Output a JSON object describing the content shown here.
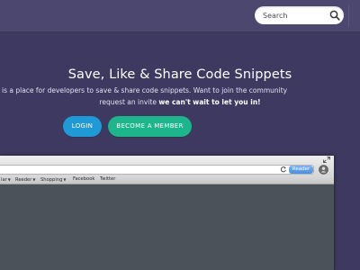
{
  "search": {
    "placeholder": "Search",
    "icon": "search-icon"
  },
  "hero": {
    "title": "Save, Like & Share Code Snippets",
    "line1": "is a place for developers to save & share code snippets. Want to join the community",
    "line2_plain": "request an invite ",
    "line2_bold": "we can't wait to let you in!"
  },
  "buttons": {
    "login": "LOGIN",
    "member": "BECOME A MEMBER"
  },
  "browser": {
    "reader_label": "Reader",
    "bookmarks": [
      {
        "label": "lar",
        "has_menu": true
      },
      {
        "label": "Reeder",
        "has_menu": true
      },
      {
        "label": "Shopping",
        "has_menu": true
      },
      {
        "label": "Facebook",
        "has_menu": false
      },
      {
        "label": "Twitter",
        "has_menu": false
      }
    ]
  },
  "colors": {
    "background": "#3e3960",
    "topbar": "#4c476f",
    "login_button": "#1e9ad6",
    "member_button": "#1db58b",
    "reader_button": "#4a8ee0"
  }
}
